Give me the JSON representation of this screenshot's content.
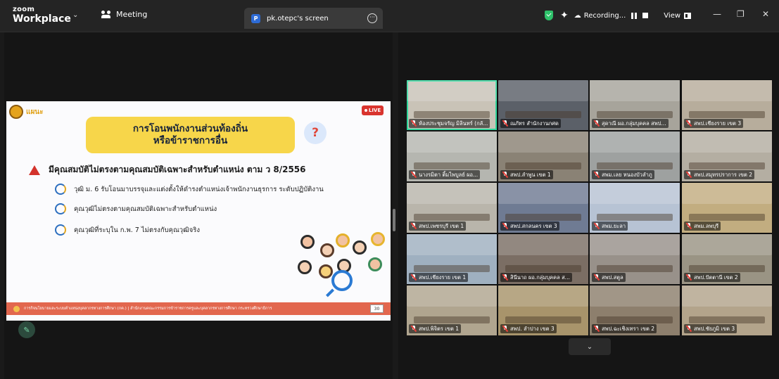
{
  "app": {
    "logo_line1": "zoom",
    "logo_line2": "Workplace"
  },
  "header": {
    "meeting_label": "Meeting",
    "share_tab": {
      "badge": "P",
      "title": "pk.otepc's screen"
    },
    "recording_label": "Recording...",
    "view_label": "View"
  },
  "slide": {
    "logo_text": "แผนะ",
    "live_label": "LIVE",
    "title_line1": "การโอนพนักงานส่วนท้องถิ่น",
    "title_line2": "หรือข้าราชการอื่น",
    "heading": "มีคุณสมบัติไม่ตรงตามคุณสมบัติเฉพาะสำหรับตำแหน่ง ตาม ว 8/2556",
    "bullets": [
      "วุฒิ ม. 6 รับโอนมาบรรจุและแต่งตั้งให้ดำรงตำแหน่งเจ้าพนักงานธุรการ ระดับปฏิบัติงาน",
      "คุณวุฒิไม่ตรงตามคุณสมบัติเฉพาะสำหรับตำแหน่ง",
      "คุณวุฒิที่ระบุใน ก.พ. 7 ไม่ตรงกับคุณวุฒิจริง"
    ],
    "footer_text": "การกิจนโยบายและระบบตำแหน่งบุคลากรทางการศึกษา (กค.)  |  สำนักงานคณะกรรมการข้าราชการครูและบุคลากรทางการศึกษา กระทรวงศึกษาธิการ",
    "page_number": "30"
  },
  "participants": [
    {
      "name": "ห้องประชุมจรัญ มิลินทร์ (กลั...",
      "bg": "#c9c3b7",
      "active": true
    },
    {
      "name": "ณภัทร สำนักงานกศด",
      "bg": "#5b6068",
      "active": false
    },
    {
      "name": "สุดาณี ผอ.กลุ่มบุคคล สพป...",
      "bg": "#a7a49b",
      "active": false
    },
    {
      "name": "สพป.เชียงราย เขต 3",
      "bg": "#b7ad9c",
      "active": false
    },
    {
      "name": "นางรมิตา ติ้มไพบูลย์ ผอ...",
      "bg": "#b5b6b0",
      "active": false
    },
    {
      "name": "สพป.ลำพูน เขต 1",
      "bg": "#8a8275",
      "active": false
    },
    {
      "name": "สพม.เลย หนองบัวลำภู",
      "bg": "#9ea1a0",
      "active": false
    },
    {
      "name": "สพป.สมุทรปราการ เขต 2",
      "bg": "#b4aea2",
      "active": false
    },
    {
      "name": "สพป.เพชรบุรี เขต 1",
      "bg": "#b9b5ab",
      "active": false
    },
    {
      "name": "สพป.สกลนคร เขต 3",
      "bg": "#6f7b93",
      "active": false
    },
    {
      "name": "สพม.ยะลา",
      "bg": "#b7c3d4",
      "active": false
    },
    {
      "name": "สพม.ลพบุรี",
      "bg": "#c2ad80",
      "active": false
    },
    {
      "name": "สพป.เชียงราย เขต 1",
      "bg": "#9fb0c0",
      "active": false
    },
    {
      "name": "สินีนาถ ผอ.กลุ่มบุคคล ส...",
      "bg": "#7b6e64",
      "active": false
    },
    {
      "name": "สพป.สตูล",
      "bg": "#98918a",
      "active": false
    },
    {
      "name": "สพป.ปัตตานี เขต 2",
      "bg": "#9a9484",
      "active": false
    },
    {
      "name": "สพป.พิจิตร เขต 1",
      "bg": "#b0a58f",
      "active": false
    },
    {
      "name": "สพป. ลำปาง เขต 3",
      "bg": "#a8946b",
      "active": false
    },
    {
      "name": "สพป.ฉะเชิงเทรา เขต 2",
      "bg": "#8d7f6d",
      "active": false
    },
    {
      "name": "สพป.ชัยภูมิ เขต 3",
      "bg": "#b3a48b",
      "active": false
    }
  ],
  "colors": {
    "accent_green": "#2fd69b",
    "banner_yellow": "#f7d64a",
    "footer_orange": "#e2674e",
    "live_red": "#d9342e"
  }
}
